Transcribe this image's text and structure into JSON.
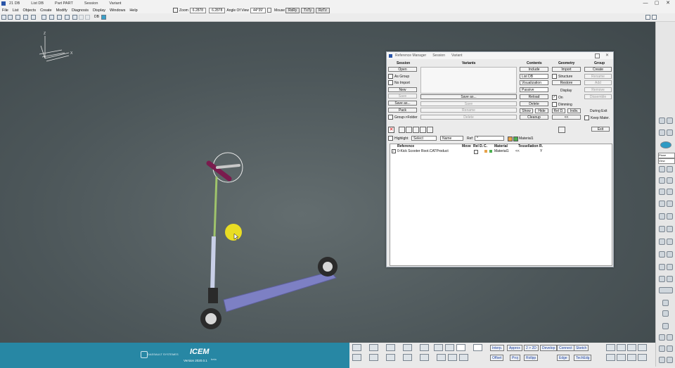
{
  "titlebar": {
    "items": [
      "21 DB",
      "List DB",
      "Part PART",
      "Session",
      "Variant"
    ]
  },
  "window_controls": {
    "minimize": "—",
    "maximize": "▢",
    "close": "✕"
  },
  "menu": [
    "File",
    "List",
    "Objects",
    "Create",
    "Modify",
    "Diagnosis",
    "Display",
    "Windows",
    "Help"
  ],
  "zoom": {
    "label": "Zoom",
    "value1": "6.2878",
    "value2": "6.2878",
    "angle_label": "Angle Of View",
    "angle_value": "44°39'",
    "mouse_label": "Mouse",
    "b1": "RxRy",
    "b2": "TxTy",
    "b3": "RzTz"
  },
  "toolbar_text": "DB",
  "footer": {
    "brand": "DASSAULT SYSTEMES",
    "product": "ICEM",
    "version": "Version 2020.0.1",
    "beta": "beta"
  },
  "footer_buttons": [
    "Interp.",
    "Approx",
    "2 > 2D",
    "Develop",
    "Connect",
    "Sketch",
    "Offset",
    "Proj",
    "Rollpp",
    "Edge",
    "TechEdg"
  ],
  "dialog": {
    "title": "Reference Manager",
    "tabs": [
      "Session",
      "Variant"
    ],
    "session": {
      "title": "Session",
      "open": "Open",
      "as_group": "As Group",
      "no_import": "No Import",
      "new": "New",
      "save": "Save",
      "save_as": "Save as...",
      "pack": "Pack",
      "group_folder": "Group->Folder"
    },
    "variants": {
      "title": "Variants",
      "save_as": "Save as...",
      "save": "Save",
      "rename": "Rename",
      "delete": "Delete"
    },
    "contents": {
      "title": "Contents",
      "include": "Include",
      "list_db": "List DB",
      "visualization": "Visualization",
      "passive": "Passive",
      "reload": "Reload",
      "delete": "Delete",
      "show": "Show",
      "hide": "Hide",
      "cleanup": "Cleanup"
    },
    "geometry": {
      "title": "Geometry",
      "import": "Import",
      "structure": "Structure",
      "restore": "Restore",
      "display_label": "Display",
      "on": "On",
      "dimming": "Dimming",
      "rel_d": "Rel D.",
      "indiv": "Indiv.",
      "arrow": "<<"
    },
    "group": {
      "title": "Group",
      "create": "Create",
      "rename": "Rename",
      "add": "Add",
      "remove": "Remove",
      "dissemble": "Dissemble",
      "during_exit": "During Exit",
      "keep_mater": "Keep Mater."
    },
    "exit": "Exit",
    "filter": {
      "highlight": "Highlight",
      "select": "Select",
      "name": "Name",
      "ref_label": "Ref:",
      "ref_value": "*",
      "material": "Material1"
    },
    "table": {
      "headers": [
        "Reference",
        "Move",
        "Rel D.",
        "C.",
        "Material",
        "Tessellation",
        "R."
      ],
      "rows": [
        {
          "name": "0-Kick Scooter Root.CATProduct",
          "material": "Material1",
          "tess": "<<",
          "r": "Y"
        }
      ]
    }
  },
  "colors": {
    "footer": "#2787a4",
    "viewport": "#4f595c",
    "scooter_deck": "#7b7fc2",
    "pointer": "#f0e421"
  }
}
